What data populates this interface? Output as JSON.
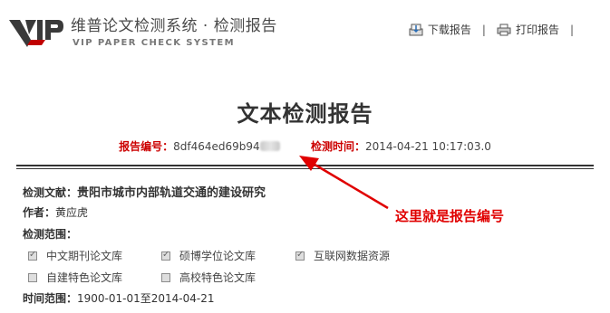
{
  "header": {
    "brand_logo_text": "VIP",
    "brand_title": "维普论文检测系统 · 检测报告",
    "brand_subtitle": "VIP PAPER CHECK SYSTEM",
    "download_label": "下载报告",
    "separator": "|",
    "print_label": "打印报告"
  },
  "report": {
    "title": "文本检测报告",
    "id_label": "报告编号：",
    "id_value": "8df464ed69b94",
    "time_label": "检测时间：",
    "time_value": "2014-04-21 10:17:03.0"
  },
  "details": {
    "doc_label": "检测文献：",
    "doc_title": "贵阳市城市内部轨道交通的建设研究",
    "author_label": "作者：",
    "author_value": "黄应虎",
    "scope_label": "检测范围：",
    "scopes": [
      {
        "label": "中文期刊论文库",
        "checked": true
      },
      {
        "label": "硕博学位论文库",
        "checked": true
      },
      {
        "label": "互联网数据资源",
        "checked": true
      },
      {
        "label": "自建特色论文库",
        "checked": false
      },
      {
        "label": "高校特色论文库",
        "checked": false
      }
    ],
    "range_label": "时间范围：",
    "range_value": "1900-01-01至2014-04-21"
  },
  "annotation": {
    "text": "这里就是报告编号",
    "color": "#e00000"
  }
}
